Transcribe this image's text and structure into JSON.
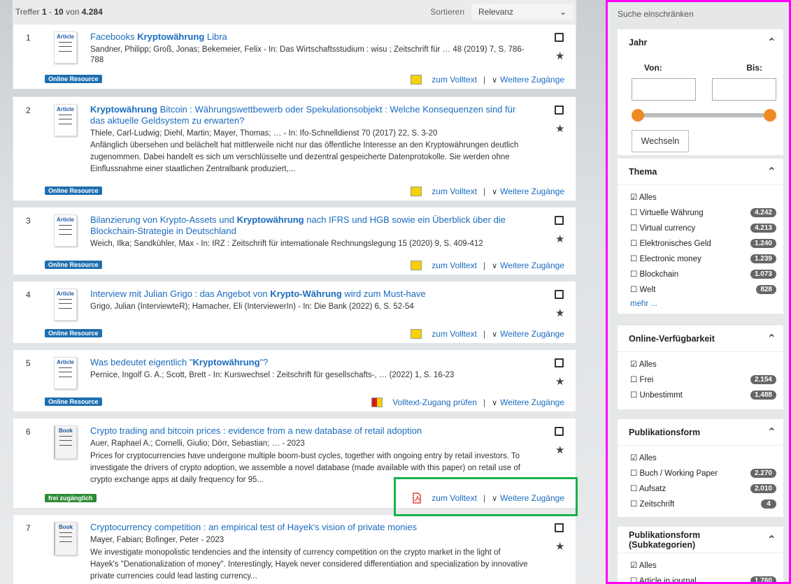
{
  "topbar": {
    "prefix": "Treffer ",
    "from": "1",
    "dash": " - ",
    "to": "10",
    "von": " von ",
    "total": "4.284",
    "sort_label": "Sortieren",
    "sort_value": "Relevanz"
  },
  "results": [
    {
      "num": "1",
      "type": "Article",
      "title_parts": [
        "Facebooks ",
        "Kryptowährung",
        " Libra"
      ],
      "meta": "Sandner, Philipp; Groß, Jonas; Bekemeier, Felix - In: Das Wirtschaftsstudium : wisu ; Zeitschrift für … 48 (2019) 7, S. 786-788",
      "abstract": "",
      "badge": "Online Resource",
      "access": "zum Volltext",
      "more": "Weitere Zugänge"
    },
    {
      "num": "2",
      "type": "Article",
      "title_parts": [
        "",
        "Kryptowährung",
        " Bitcoin : Währungswettbewerb oder Spekulationsobjekt : Welche Konsequenzen sind für das aktuelle Geldsystem zu erwarten?"
      ],
      "meta": "Thiele, Carl-Ludwig; Diehl, Martin; Mayer, Thomas; … - In: Ifo-Schnelldienst 70 (2017) 22, S. 3-20",
      "abstract": "Anfänglich übersehen und belächelt hat mittlerweile nicht nur das öffentliche Interesse an den Kryptowährungen deutlich zugenommen. Dabei handelt es sich um verschlüsselte und dezentral gespeicherte Datenprotokolle. Sie werden ohne Einflussnahme einer staatlichen Zentralbank produziert,...",
      "badge": "Online Resource",
      "access": "zum Volltext",
      "more": "Weitere Zugänge"
    },
    {
      "num": "3",
      "type": "Article",
      "title_parts": [
        "Bilanzierung von Krypto-Assets und ",
        "Kryptowährung",
        " nach IFRS und HGB sowie ein Überblick über die Blockchain-Strategie in Deutschland"
      ],
      "meta": "Weich, Ilka; Sandkühler, Max - In: IRZ : Zeitschrift für internationale Rechnungslegung 15 (2020) 9, S. 409-412",
      "abstract": "",
      "badge": "Online Resource",
      "access": "zum Volltext",
      "more": "Weitere Zugänge"
    },
    {
      "num": "4",
      "type": "Article",
      "title_parts": [
        "Interview mit Julian Grigo : das Angebot von ",
        "Krypto-Währung",
        " wird zum Must-have"
      ],
      "meta": "Grigo, Julian (InterviewteR); Hamacher, Eli (InterviewerIn) - In: Die Bank (2022) 6, S. 52-54",
      "abstract": "",
      "badge": "Online Resource",
      "access": "zum Volltext",
      "more": "Weitere Zugänge"
    },
    {
      "num": "5",
      "type": "Article",
      "title_parts": [
        "Was bedeutet eigentlich \"",
        "Kryptowährung",
        "\"?"
      ],
      "meta": "Pernice, Ingolf G. A.; Scott, Brett - In: Kurswechsel : Zeitschrift für gesellschafts-, … (2022) 1, S. 16-23",
      "abstract": "",
      "badge": "Online Resource",
      "access": "Volltext-Zugang prüfen",
      "more": "Weitere Zugänge"
    },
    {
      "num": "6",
      "type": "Book",
      "title_parts": [
        "Crypto trading and bitcoin prices : evidence from a new database of retail adoption",
        "",
        ""
      ],
      "meta": "Auer, Raphael A.; Cornelli, Giulio; Dörr, Sebastian; … - 2023",
      "abstract": "Prices for cryptocurrencies have undergone multiple boom-bust cycles, together with ongoing entry by retail investors. To investigate the drivers of crypto adoption, we assemble a novel database (made available with this paper) on retail use of crypto exchange apps at daily frequency for 95...",
      "badge": "frei zugänglich",
      "access": "zum Volltext",
      "more": "Weitere Zugänge"
    },
    {
      "num": "7",
      "type": "Book",
      "title_parts": [
        "Cryptocurrency competition : an empirical test of Hayek's vision of private monies",
        "",
        ""
      ],
      "meta": "Mayer, Fabian; Bofinger, Peter - 2023",
      "abstract": "We investigate monopolistic tendencies and the intensity of currency competition on the crypto market in the light of Hayek's \"Denationalization of money\". Interestingly, Hayek never considered differentiation and specialization by innovative private currencies could lead lasting currency...",
      "badge": "",
      "access": "",
      "more": ""
    }
  ],
  "sidebar": {
    "header": "Suche einschränken",
    "jahr": {
      "title": "Jahr",
      "von": "Von:",
      "bis": "Bis:",
      "von_value": "",
      "bis_value": "",
      "button": "Wechseln"
    },
    "thema": {
      "title": "Thema",
      "items": [
        {
          "label": "☑ Alles",
          "count": ""
        },
        {
          "label": "☐ Virtuelle Währung",
          "count": "4.242"
        },
        {
          "label": "☐ Virtual currency",
          "count": "4.213"
        },
        {
          "label": "☐ Elektronisches Geld",
          "count": "1.240"
        },
        {
          "label": "☐ Electronic money",
          "count": "1.239"
        },
        {
          "label": "☐ Blockchain",
          "count": "1.073"
        },
        {
          "label": "☐ Welt",
          "count": "828"
        }
      ],
      "more": "mehr ..."
    },
    "online": {
      "title": "Online-Verfügbarkeit",
      "items": [
        {
          "label": "☑ Alles",
          "count": ""
        },
        {
          "label": "☐ Frei",
          "count": "2.154"
        },
        {
          "label": "☐ Unbestimmt",
          "count": "1.488"
        }
      ]
    },
    "pubform": {
      "title": "Publikationsform",
      "items": [
        {
          "label": "☑ Alles",
          "count": ""
        },
        {
          "label": "☐ Buch / Working Paper",
          "count": "2.270"
        },
        {
          "label": "☐ Aufsatz",
          "count": "2.010"
        },
        {
          "label": "☐ Zeitschrift",
          "count": "4"
        }
      ]
    },
    "pubsub": {
      "title": "Publikationsform (Subkategorien)",
      "items": [
        {
          "label": "☑ Alles",
          "count": ""
        },
        {
          "label": "☐ Article in journal",
          "count": "1.760"
        }
      ]
    }
  }
}
